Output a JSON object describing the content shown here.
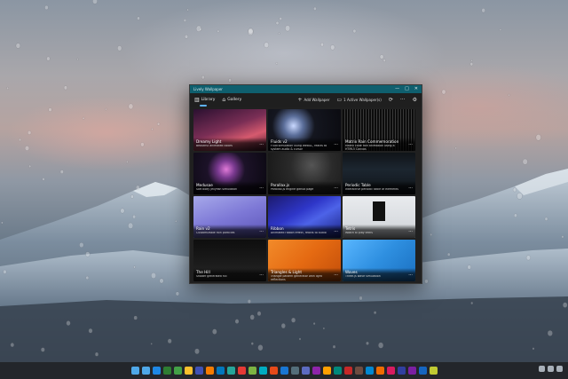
{
  "window": {
    "title": "Lively Wallpaper",
    "controls": [
      "—",
      "□",
      "✕"
    ]
  },
  "toolbar": {
    "tabs": [
      {
        "label": "Library",
        "icon": "library-icon"
      },
      {
        "label": "Gallery",
        "icon": "gallery-icon"
      }
    ],
    "actions": [
      {
        "label": "Add Wallpaper",
        "icon": "plus-icon"
      },
      {
        "label": "1 Active Wallpaper(s)",
        "icon": "display-icon"
      }
    ],
    "extra_icons": [
      "settings-icon",
      "more-icon",
      "gear-icon"
    ]
  },
  "wallpapers": [
    {
      "name": "Dreamy Light",
      "desc": "Beautiful animated colors",
      "theme": "dreamy"
    },
    {
      "name": "Fluids v2",
      "desc": "Fluid simulation using WebGL, reacts to system audio & cursor",
      "theme": "fluids"
    },
    {
      "name": "Matrix Rain Commemoration",
      "desc": "Matrix code rain animation using a HTML5 Canvas",
      "theme": "matrix"
    },
    {
      "name": "Medusae",
      "desc": "Soft body jellyfish simulation",
      "theme": "medusae"
    },
    {
      "name": "Parallax.js",
      "desc": "Parallax.js engine github page",
      "theme": "parallax"
    },
    {
      "name": "Periodic Table",
      "desc": "Interactive periodic table of elements",
      "theme": "periodic"
    },
    {
      "name": "Rain v2",
      "desc": "Customizable rain particles",
      "theme": "rain"
    },
    {
      "name": "Ribbon",
      "desc": "Animated ribbon effect, reacts to audio",
      "theme": "ribbon"
    },
    {
      "name": "Tetris",
      "desc": "Watch ai play tetris",
      "theme": "tetris"
    },
    {
      "name": "The Hill",
      "desc": "Shader generated hill",
      "theme": "hill"
    },
    {
      "name": "Triangles & Light",
      "desc": "Triangle pattern generator with light reflections",
      "theme": "triangles"
    },
    {
      "name": "Waves",
      "desc": "Three.js wave simulation",
      "theme": "waves"
    }
  ],
  "colors": {
    "titlebar": "#0f5f6e",
    "accent": "#5fb2ff",
    "window_bg": "#202020"
  },
  "taskbar": {
    "app_colors": [
      "#4fa8e8",
      "#1e88e5",
      "#2e7d32",
      "#43a047",
      "#fbc02d",
      "#3f51b5",
      "#f57c00",
      "#0277bd",
      "#26a69a",
      "#e53935",
      "#7cb342",
      "#00acc1",
      "#e64a19",
      "#1976d2",
      "#546e7a",
      "#5c6bc0",
      "#8e24aa",
      "#ffa000",
      "#00897b",
      "#c62828",
      "#6d4c41",
      "#0288d1",
      "#ef6c00",
      "#d81b60",
      "#303f9f",
      "#7b1fa2",
      "#1565c0",
      "#c0ca33"
    ]
  }
}
